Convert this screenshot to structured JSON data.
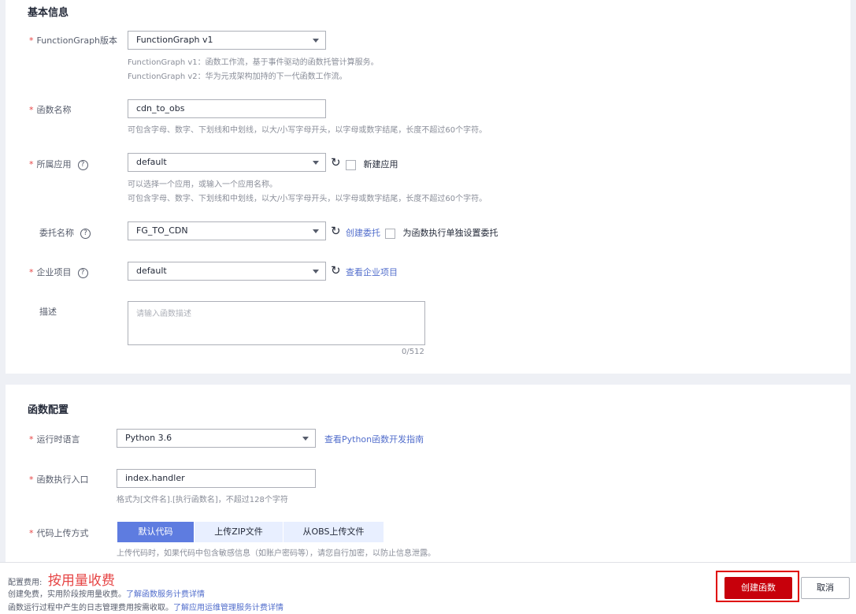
{
  "basic": {
    "title": "基本信息",
    "version": {
      "label": "FunctionGraph版本",
      "value": "FunctionGraph v1",
      "hint1": "FunctionGraph v1：函数工作流，基于事件驱动的函数托管计算服务。",
      "hint2": "FunctionGraph v2：华为元戎架构加持的下一代函数工作流。"
    },
    "name": {
      "label": "函数名称",
      "value": "cdn_to_obs",
      "hint": "可包含字母、数字、下划线和中划线，以大/小写字母开头，以字母或数字结尾，长度不超过60个字符。"
    },
    "app": {
      "label": "所属应用",
      "value": "default",
      "new_app": "新建应用",
      "hint1": "可以选择一个应用，或输入一个应用名称。",
      "hint2": "可包含字母、数字、下划线和中划线，以大/小写字母开头，以字母或数字结尾，长度不超过60个字符。"
    },
    "agency": {
      "label": "委托名称",
      "value": "FG_TO_CDN",
      "create_link": "创建委托",
      "separate": "为函数执行单独设置委托"
    },
    "project": {
      "label": "企业项目",
      "value": "default",
      "view_link": "查看企业项目"
    },
    "desc": {
      "label": "描述",
      "placeholder": "请输入函数描述",
      "counter": "0/512"
    }
  },
  "config": {
    "title": "函数配置",
    "runtime": {
      "label": "运行时语言",
      "value": "Python 3.6",
      "guide_link": "查看Python函数开发指南"
    },
    "handler": {
      "label": "函数执行入口",
      "value": "index.handler",
      "hint": "格式为[文件名].[执行函数名]，不超过128个字符"
    },
    "upload": {
      "label": "代码上传方式",
      "tabs": [
        "默认代码",
        "上传ZIP文件",
        "从OBS上传文件"
      ],
      "hint": "上传代码时，如果代码中包含敏感信息（如账户密码等），请您自行加密，以防止信息泄露。"
    }
  },
  "footer": {
    "fee_label": "配置费用:",
    "fee_value": "按用量收费",
    "line1_text": "创建免费，实用阶段按用量收费。",
    "line1_link": "了解函数服务计费详情",
    "line2_text": "函数运行过程中产生的日志管理费用按需收取。",
    "line2_link": "了解应用运维管理服务计费详情",
    "create_btn": "创建函数",
    "cancel_btn": "取消"
  },
  "colors": {
    "primary": "#c7000b",
    "link": "#526ecc",
    "required": "#e64545",
    "tab_active": "#5e7ce0",
    "tab_inactive": "#e8efff"
  }
}
